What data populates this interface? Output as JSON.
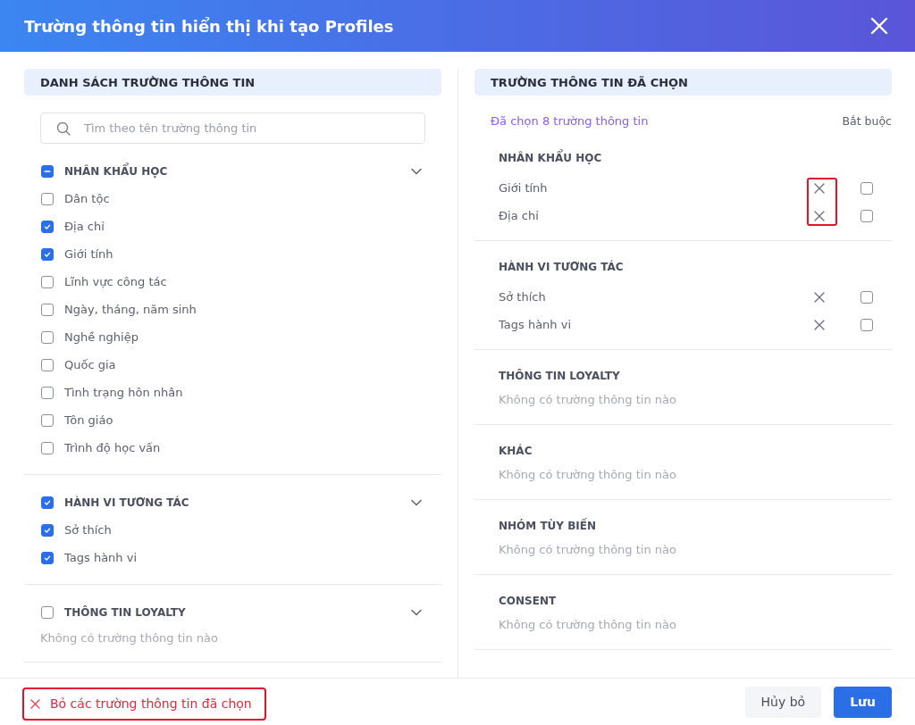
{
  "dialog": {
    "title": "Trường thông tin hiển thị khi tạo Profiles"
  },
  "field_list": {
    "heading": "DANH SÁCH TRƯỜNG THÔNG TIN",
    "search": {
      "placeholder": "Tìm theo tên trường thông tin"
    },
    "groups": [
      {
        "name": "NHÂN KHẨU HỌC",
        "indeterminate": true,
        "expanded": true,
        "items": [
          {
            "label": "Dân tộc",
            "checked": false
          },
          {
            "label": "Địa chỉ",
            "checked": true
          },
          {
            "label": "Giới tính",
            "checked": true
          },
          {
            "label": "Lĩnh vực công tác",
            "checked": false
          },
          {
            "label": "Ngày, tháng, năm sinh",
            "checked": false
          },
          {
            "label": "Nghề nghiệp",
            "checked": false
          },
          {
            "label": "Quốc gia",
            "checked": false
          },
          {
            "label": "Tình trạng hôn nhân",
            "checked": false
          },
          {
            "label": "Tôn giáo",
            "checked": false
          },
          {
            "label": "Trình độ học vấn",
            "checked": false
          }
        ]
      },
      {
        "name": "HÀNH VI TƯƠNG TÁC",
        "checked": true,
        "expanded": true,
        "items": [
          {
            "label": "Sở thích",
            "checked": true
          },
          {
            "label": "Tags hành vi",
            "checked": true
          }
        ]
      },
      {
        "name": "THÔNG TIN LOYALTY",
        "checked": false,
        "expanded": true,
        "empty_text": "Không có trường thông tin nào"
      }
    ]
  },
  "selected_fields": {
    "heading": "TRƯỜNG THÔNG TIN ĐÃ CHỌN",
    "count_text": "Đã chọn 8 trường thông tin",
    "required_label": "Bắt buộc",
    "groups": [
      {
        "name": "NHÂN KHẨU HỌC",
        "remove_highlighted": true,
        "rows": [
          {
            "label": "Giới tính",
            "required": false
          },
          {
            "label": "Địa chỉ",
            "required": false
          }
        ]
      },
      {
        "name": "HÀNH VI TƯƠNG TÁC",
        "rows": [
          {
            "label": "Sở thích",
            "required": false
          },
          {
            "label": "Tags hành vi",
            "required": false
          }
        ]
      },
      {
        "name": "THÔNG TIN LOYALTY",
        "empty_text": "Không có trường thông tin nào"
      },
      {
        "name": "KHÁC",
        "empty_text": "Không có trường thông tin nào"
      },
      {
        "name": "NHÓM TÙY BIẾN",
        "empty_text": "Không có trường thông tin nào"
      },
      {
        "name": "CONSENT",
        "empty_text": "Không có trường thông tin nào"
      }
    ]
  },
  "footer": {
    "clear_button": {
      "label": "Bỏ các trường thông tin đã chọn",
      "highlighted": true
    },
    "cancel_button": "Hủy bỏ",
    "save_button": "Lưu"
  }
}
